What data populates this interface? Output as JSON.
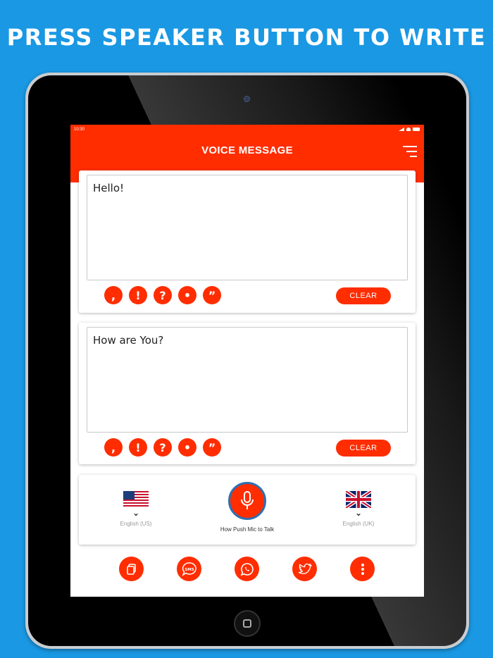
{
  "headline": "PRESS SPEAKER BUTTON TO WRITE",
  "status_bar": {
    "time": "10:30"
  },
  "app": {
    "title": "VOICE MESSAGE"
  },
  "message_boxes": [
    {
      "text": "Hello!",
      "clear_label": "CLEAR"
    },
    {
      "text": "How are You?",
      "clear_label": "CLEAR"
    }
  ],
  "punctuation": [
    ",",
    "!",
    "?",
    "•",
    "”"
  ],
  "languages": {
    "source": {
      "label": "English (US)",
      "flag": "us-flag-icon"
    },
    "target": {
      "label": "English (UK)",
      "flag": "uk-flag-icon"
    }
  },
  "mic": {
    "label": "How Push Mic to Talk"
  },
  "actions": [
    "copy-icon",
    "sms-icon",
    "whatsapp-icon",
    "twitter-icon",
    "more-icon"
  ],
  "colors": {
    "accent": "#ff2d00",
    "background": "#1a98e3",
    "mic_ring": "#2f6fb0"
  }
}
